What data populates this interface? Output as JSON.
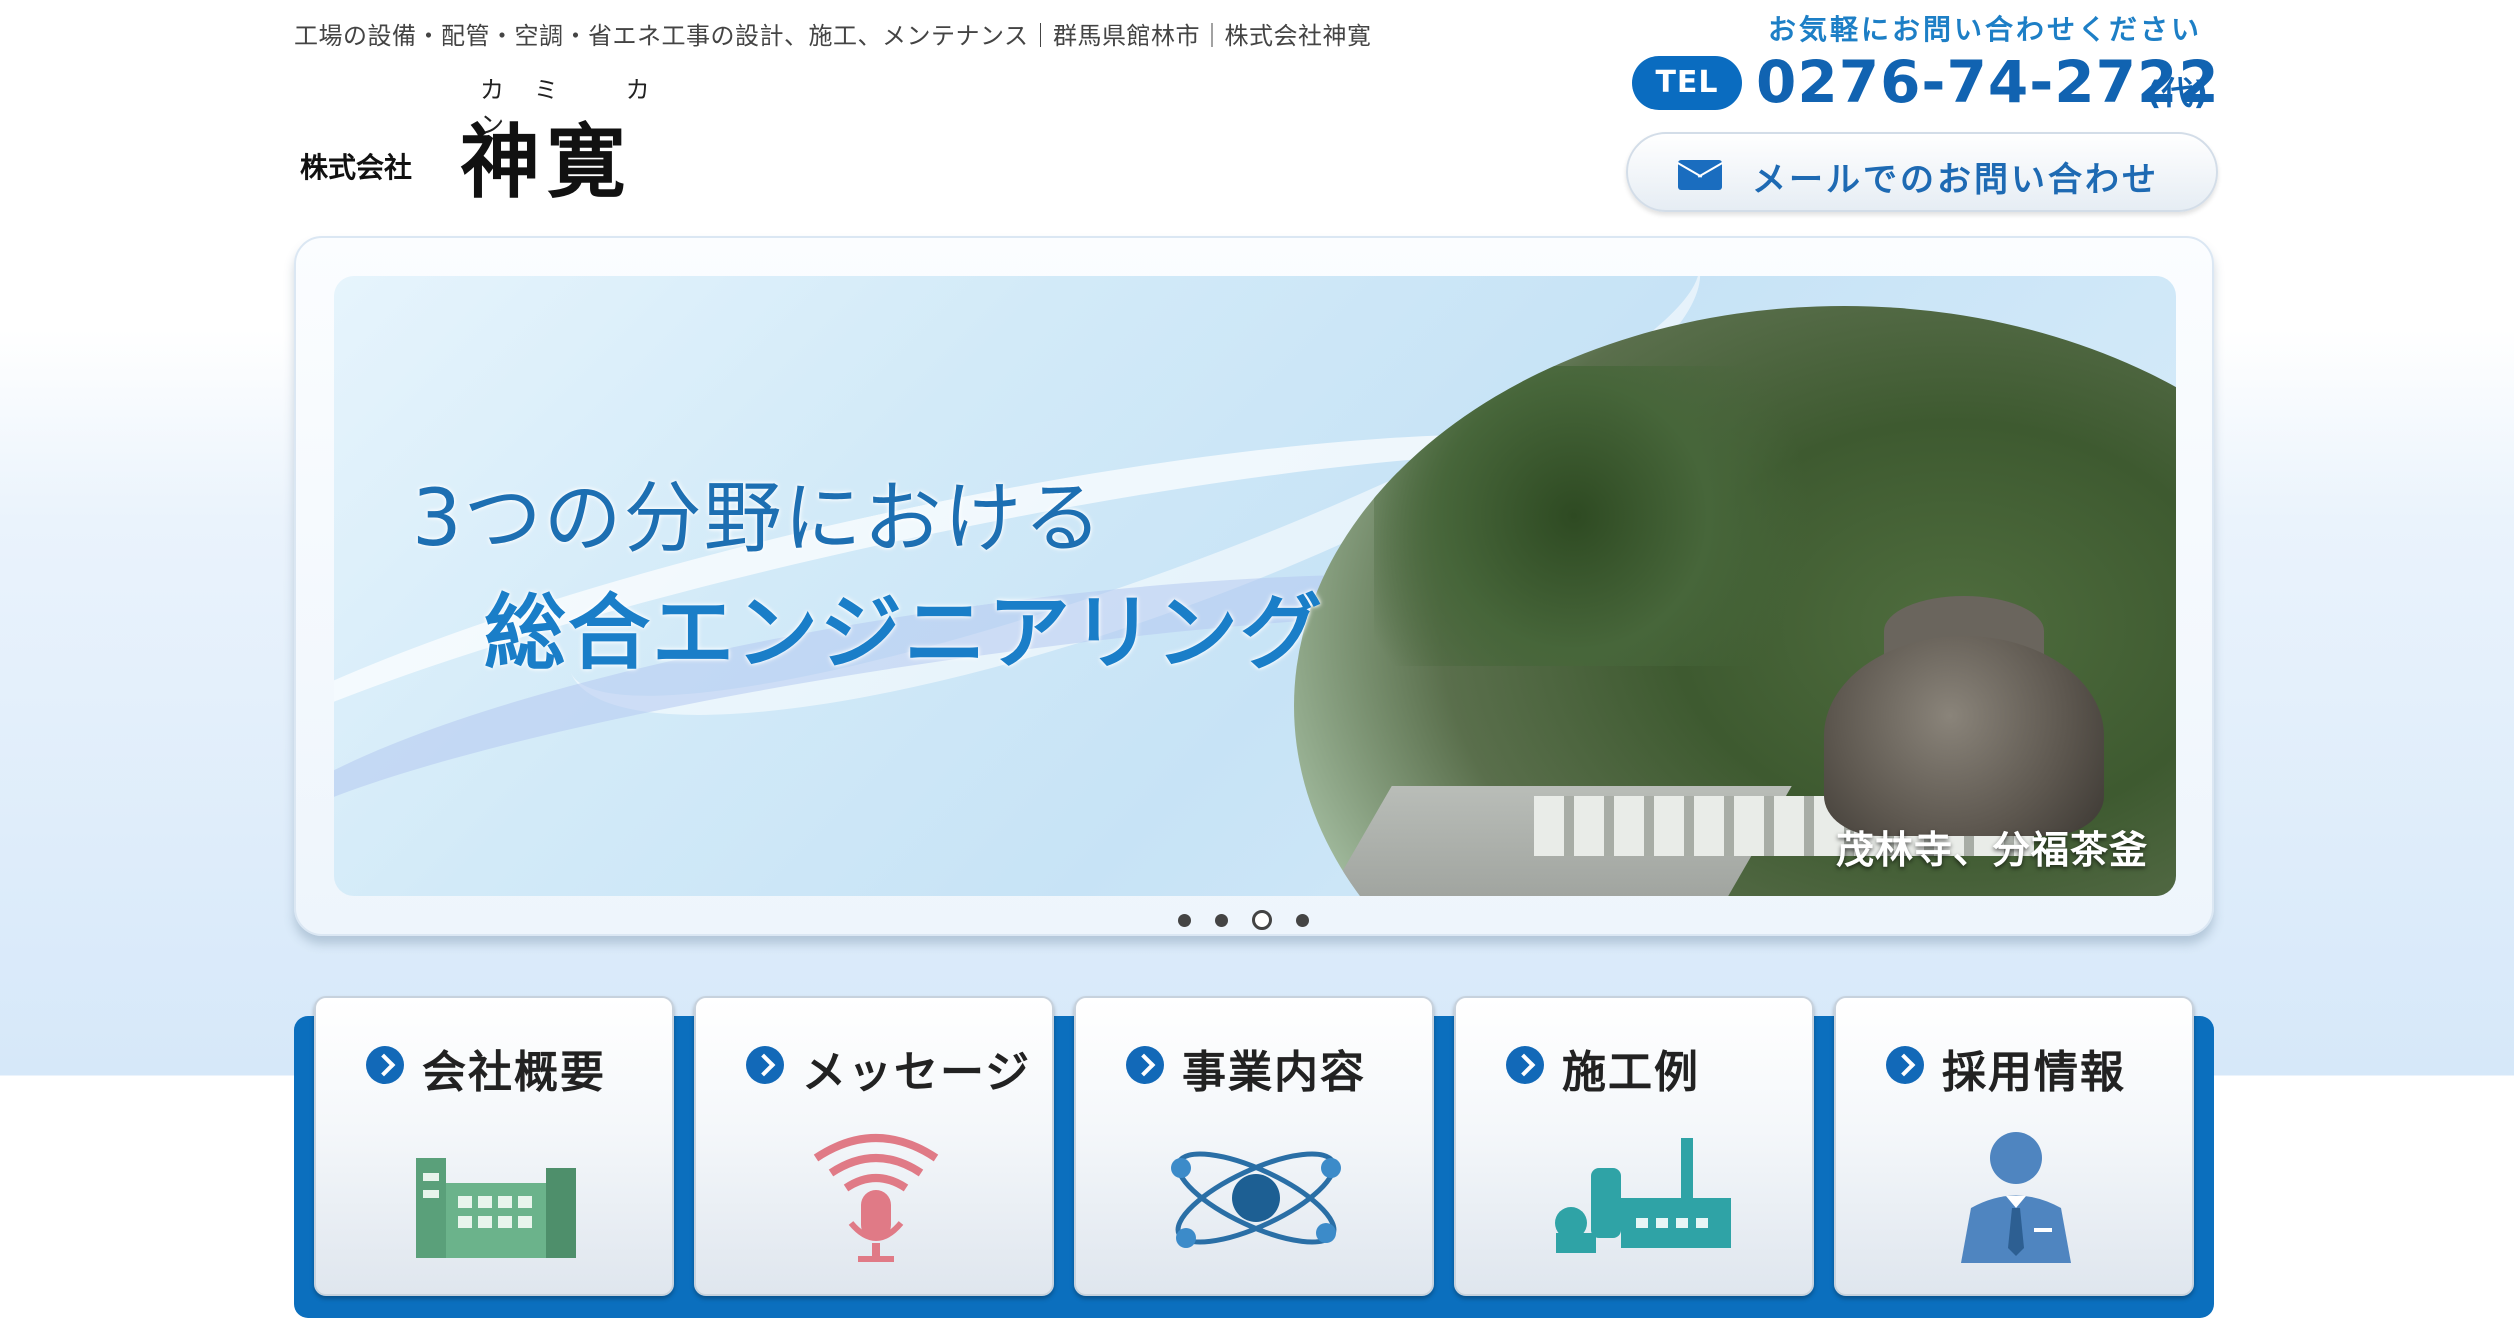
{
  "header": {
    "tagline": "工場の設備・配管・空調・省エネ工事の設計、施工、メンテナンス｜群馬県館林市｜株式会社神寛",
    "logo": {
      "prefix": "株式会社",
      "name": "神寛",
      "ruby": "カミ カン"
    }
  },
  "contact": {
    "note": "お気軽にお問い合わせください",
    "tel_badge": "TEL",
    "tel_number": "0276-74-2722",
    "tel_suffix": "(代)",
    "mail_button": "メールでのお問い合わせ"
  },
  "slider": {
    "headline": "3つの分野における",
    "subline": "総合エンジニアリング",
    "caption": "茂林寺、分福茶釜",
    "dots": 4,
    "active_dot": 3
  },
  "nav": {
    "tiles": [
      {
        "label": "会社概要",
        "icon": "factory-building-icon"
      },
      {
        "label": "メッセージ",
        "icon": "microphone-icon"
      },
      {
        "label": "事業内容",
        "icon": "atom-icon"
      },
      {
        "label": "施工例",
        "icon": "industrial-plant-icon"
      },
      {
        "label": "採用情報",
        "icon": "business-person-icon"
      }
    ]
  },
  "colors": {
    "brand_blue": "#0b6fbe",
    "text_blue": "#1163b1",
    "factory_green": "#5aa07a",
    "mic_pink": "#e07a86",
    "atom_blue": "#2a6fa6",
    "plant_teal": "#2fa3a6",
    "person_blue": "#4f85c0"
  }
}
